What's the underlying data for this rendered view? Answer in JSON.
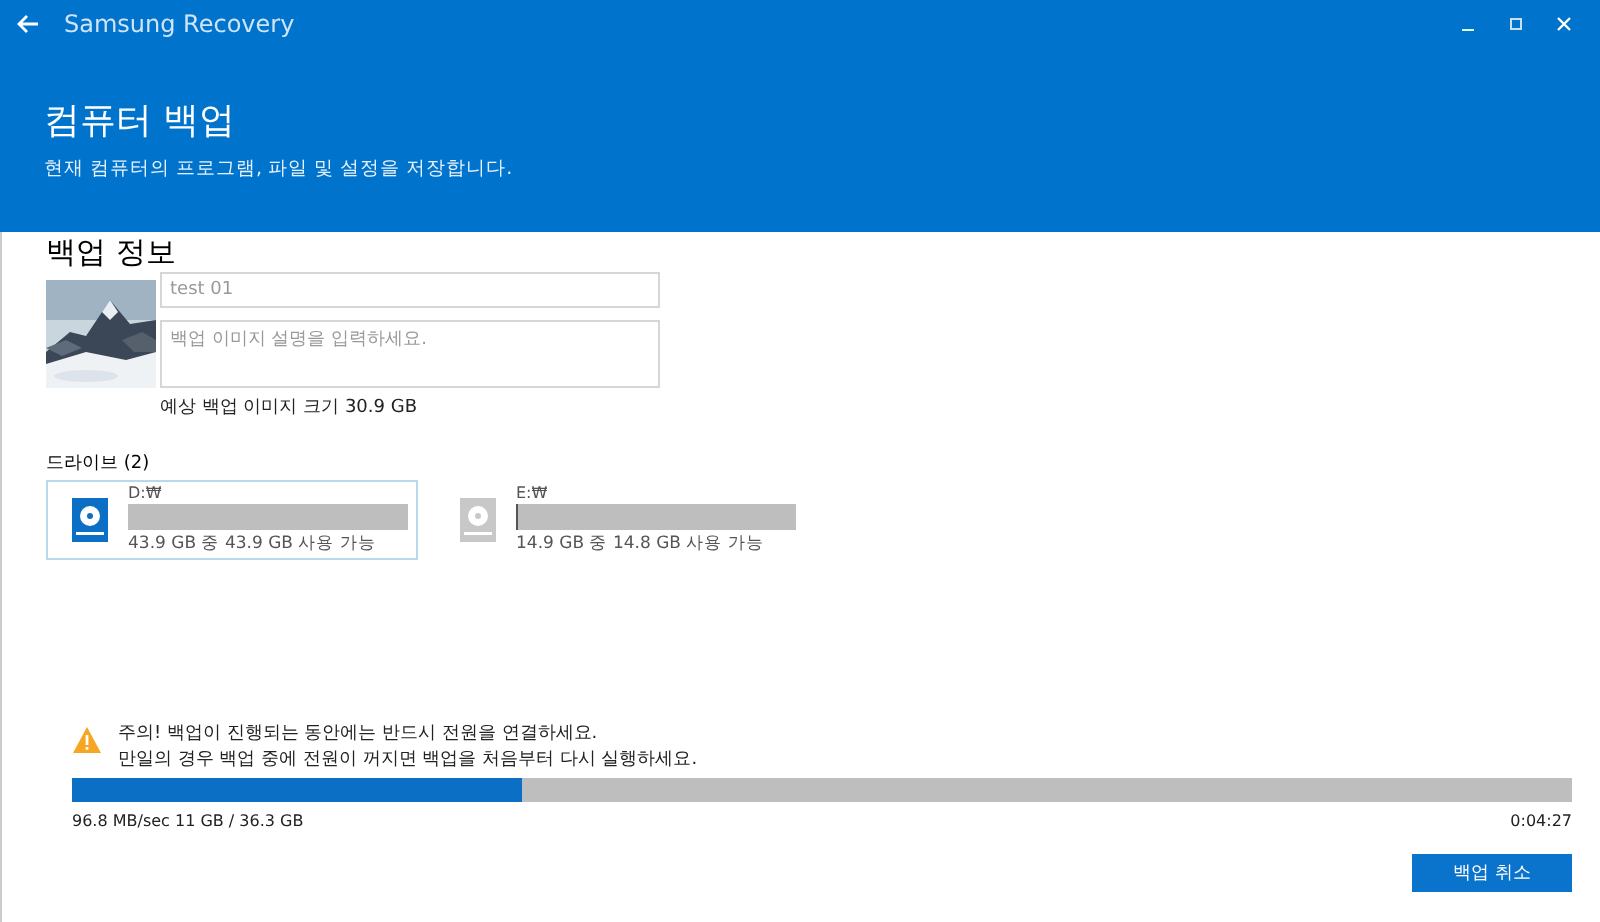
{
  "window": {
    "title": "Samsung Recovery"
  },
  "header": {
    "title": "컴퓨터 백업",
    "subtitle": "현재 컴퓨터의 프로그램, 파일 및 설정을 저장합니다."
  },
  "backup_info": {
    "title": "백업 정보",
    "name_field": {
      "value": "test 01"
    },
    "description_field": {
      "placeholder": "백업 이미지 설명을 입력하세요."
    },
    "size_label": "예상 백업 이미지 크기 30.9 GB"
  },
  "drives": {
    "title": "드라이브 (2)",
    "items": [
      {
        "name": "D:₩",
        "level": 0,
        "capacity": "43.9 GB 중 43.9 GB 사용 가능",
        "selected": true
      },
      {
        "name": "E:₩",
        "level": 0.01,
        "capacity": "14.9 GB 중 14.8 GB 사용 가능",
        "selected": false
      }
    ]
  },
  "warning": {
    "lines": [
      "주의! 백업이 진행되는 동안에는 반드시 전원을 연결하세요.",
      "만일의 경우 백업 중에 전원이 꺼지면 백업을 처음부터 다시 실행하세요."
    ]
  },
  "progress": {
    "level": 0.3,
    "stats": "96.8 MB/sec 11 GB / 36.3 GB",
    "remaining": "0:04:27"
  },
  "buttons": [
    "백업 취소"
  ]
}
